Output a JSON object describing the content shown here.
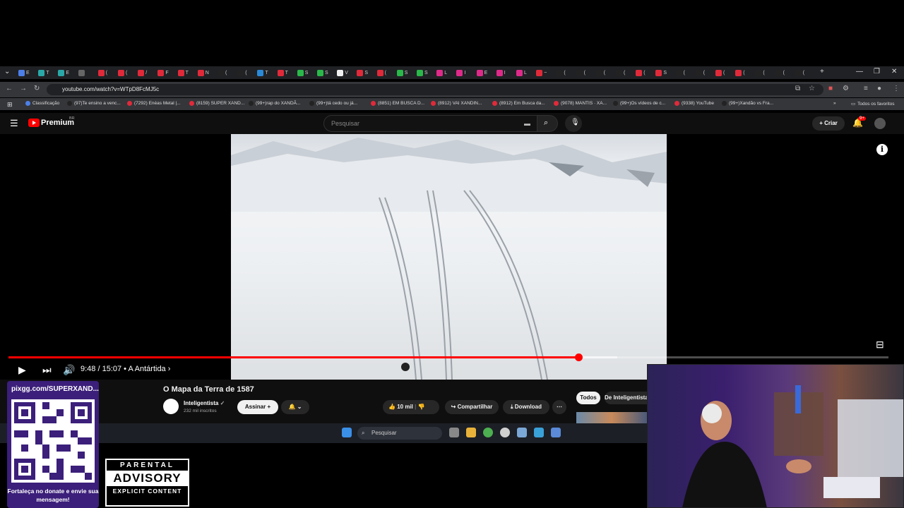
{
  "browser": {
    "tabs": [
      "E",
      "T",
      "E",
      "",
      "(",
      "(",
      "/",
      "F",
      "T",
      "N",
      "(",
      "(",
      "T",
      "T",
      "S",
      "S",
      "V",
      "S",
      "(",
      "S",
      "S",
      "L",
      "I",
      "E",
      "I",
      "L",
      "~",
      "(",
      "(",
      "(",
      "(",
      "(",
      "S",
      "(",
      "(",
      "(",
      "(",
      "(",
      "(",
      "("
    ],
    "url": "youtube.com/watch?v=WTpD8FcMJ5c",
    "bookmarks": [
      "Classificação",
      "(97)Te ensino a venc...",
      "(7292) Enéas Metal |...",
      "(8159) SUPER XAND...",
      "(99+)rap do XANDÃ...",
      "(99+)tá cedo ou já...",
      "(8851) EM BUSCA D...",
      "(8912) VAI XANDIN...",
      "(8912) Em Busca da...",
      "(9078) MANTIS · XA...",
      "(99+)Os vídeos de c...",
      "(9338) YouTube",
      "(99+)Xandão vs Fra..."
    ],
    "all_bookmarks": "Todos os favoritos"
  },
  "youtube": {
    "logo": "Premium",
    "region": "BR",
    "search_placeholder": "Pesquisar",
    "create": "Criar",
    "notif_count": "9+"
  },
  "player": {
    "time": "9:48 / 15:07",
    "chapter": "• A Antártida ›",
    "progress": 0.648,
    "buffered": 0.692
  },
  "video": {
    "title": "O Mapa da Terra de 1587",
    "channel": "Inteligentista",
    "subscribers": "232 mil inscritos",
    "subscribe": "Assinar",
    "likes": "10 mil",
    "share": "Compartilhar",
    "download": "Download",
    "chip_all": "Todos",
    "chip_channel": "De Inteligentista"
  },
  "taskbar": {
    "search": "Pesquisar"
  },
  "overlay": {
    "donate_url": "pixgg.com/SUPERXAND...",
    "donate_msg": "Fortaleça no donate e envie sua mensagem!",
    "advisory_top": "PARENTAL",
    "advisory_mid": "ADVISORY",
    "advisory_bot": "EXPLICIT CONTENT"
  },
  "colors": {
    "accent": "#ff0000",
    "yt_bg": "#0f0f0f",
    "chrome_bg": "#202124"
  }
}
